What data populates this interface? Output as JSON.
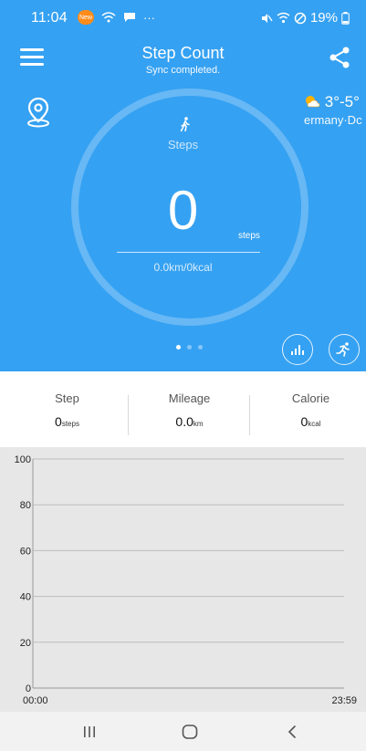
{
  "status_bar": {
    "time": "11:04",
    "battery": "19%",
    "badge": "New"
  },
  "header": {
    "title": "Step Count",
    "subtitle": "Sync completed."
  },
  "weather": {
    "temperature": "3°-5°",
    "location": "ermany·Dc",
    "icon": "partly-cloudy-icon"
  },
  "ring": {
    "label": "Steps",
    "value": "0",
    "unit": "steps",
    "summary": "0.0km/0kcal"
  },
  "pager": {
    "page_count": 3,
    "active_page": 0
  },
  "stats": [
    {
      "label": "Step",
      "value": "0",
      "unit": "steps"
    },
    {
      "label": "Mileage",
      "value": "0.0",
      "unit": "km"
    },
    {
      "label": "Calorie",
      "value": "0",
      "unit": "kcal"
    }
  ],
  "chart_data": {
    "type": "line",
    "x": [
      "00:00",
      "23:59"
    ],
    "x_start_label": "00:00",
    "x_end_label": "23:59",
    "yticks": [
      0,
      20,
      40,
      60,
      80,
      100
    ],
    "ylim": [
      0,
      100
    ],
    "series": [],
    "grid": true
  },
  "colors": {
    "primary": "#35a1f2",
    "chart_bg": "#e7e7e7"
  }
}
